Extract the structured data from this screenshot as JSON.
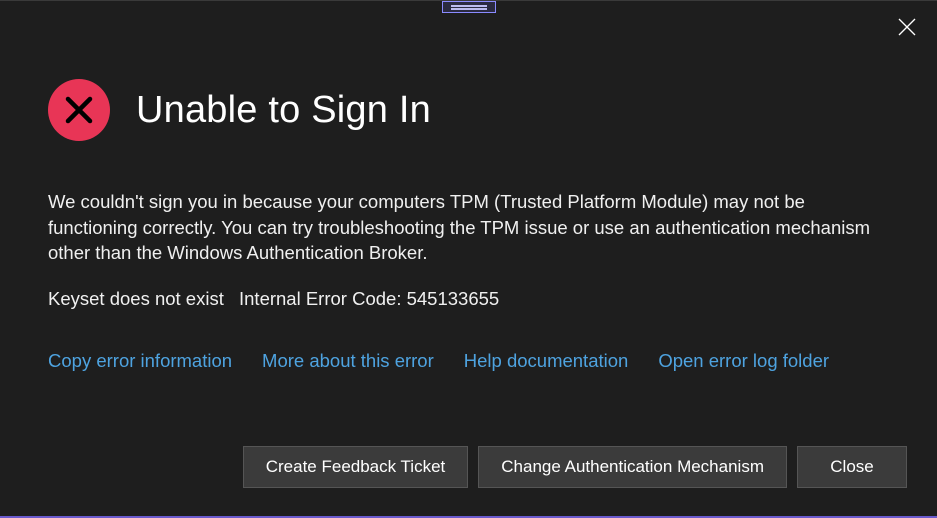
{
  "dialog": {
    "title": "Unable to Sign In",
    "message": "We couldn't sign you in because your computers TPM (Trusted Platform Module) may not be functioning correctly. You can try troubleshooting the TPM issue or use an authentication mechanism other than the Windows Authentication Broker.",
    "error_short": "Keyset does not exist",
    "error_code_label": "Internal Error Code:",
    "error_code": "545133655"
  },
  "links": {
    "copy": "Copy error information",
    "more": "More about this error",
    "help": "Help documentation",
    "open_log": "Open error log folder"
  },
  "buttons": {
    "feedback": "Create Feedback Ticket",
    "change_auth": "Change Authentication Mechanism",
    "close": "Close"
  }
}
